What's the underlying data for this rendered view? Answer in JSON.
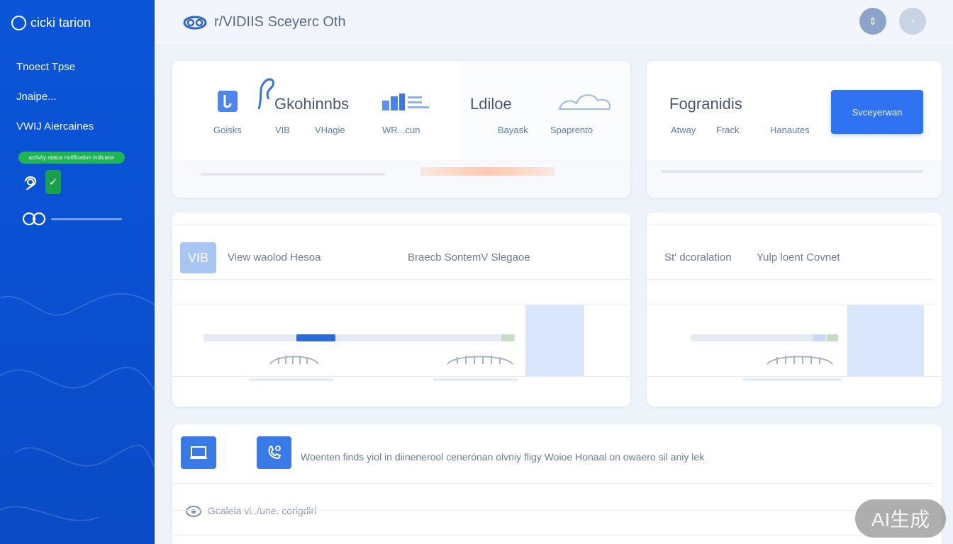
{
  "sidebar": {
    "brand": "cicki tarion",
    "items": [
      {
        "label": "Tnoect Tpse"
      },
      {
        "label": "Jnaipe..."
      },
      {
        "label": "VWIJ   Aiercaines"
      }
    ],
    "badge": "activity status notification indicator"
  },
  "header": {
    "title": "r/VIDIIS Sceyerc Oth"
  },
  "card1": {
    "title_a": "Gkohinnbs",
    "title_b": "Ldiloe",
    "labels": [
      "Goisks",
      "VIB",
      "VHagie",
      "WR...cun",
      "Bayask",
      "Spaprento"
    ]
  },
  "card2": {
    "title": "Fogranidis",
    "labels": [
      "Atway",
      "Frack",
      "Hanautes"
    ],
    "button": "Svceyerwan"
  },
  "card3": {
    "icon_label": "VIB",
    "heading_a": "View waolod Hesoa",
    "heading_b": "Braecb SontemV Slegaoe"
  },
  "card4": {
    "heading_a": "St' dcoralation",
    "heading_b": "Yulp loent Covnet"
  },
  "card5": {
    "sentence": "Woenten finds yiol in diinenerool cenerónan olvniy fligy   Woioe Honaal on owaero sil aniy lek",
    "row2": "Gcalela vi../une. corigdiri"
  },
  "watermark": "AI生成",
  "colors": {
    "sidebar": "#0b55d8",
    "accent": "#2f73f2",
    "success": "#1fb454"
  }
}
